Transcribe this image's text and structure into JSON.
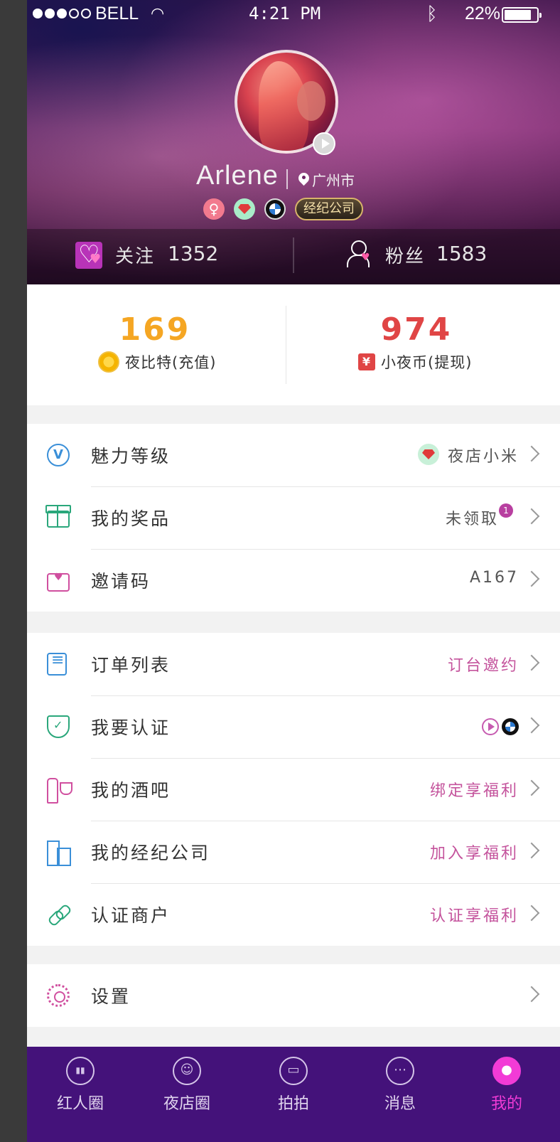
{
  "status_bar": {
    "carrier": "BELL",
    "time": "4:21 PM",
    "battery": "22%",
    "battery_level": 0.85
  },
  "profile": {
    "name": "Arlene",
    "location": "广州市",
    "gender_symbol": "♀",
    "agency_badge": "经纪公司",
    "follow_label": "关注",
    "follow_count": "1352",
    "fans_label": "粉丝",
    "fans_count": "1583"
  },
  "wallet": {
    "left_value": "169",
    "left_label": "夜比特(充值)",
    "right_value": "974",
    "right_label": "小夜币(提现)",
    "yen_symbol": "¥"
  },
  "group1": [
    {
      "label": "魅力等级",
      "right": "夜店小米",
      "icon": "v-badge-icon"
    },
    {
      "label": "我的奖品",
      "right": "未领取",
      "badge": "1",
      "icon": "gift-icon"
    },
    {
      "label": "邀请码",
      "right": "A167",
      "icon": "invite-mail-icon"
    }
  ],
  "group2": [
    {
      "label": "订单列表",
      "right": "订台邀约",
      "icon": "clipboard-icon"
    },
    {
      "label": "我要认证",
      "right": "",
      "icon": "shield-check-icon"
    },
    {
      "label": "我的酒吧",
      "right": "绑定享福利",
      "icon": "wine-icon"
    },
    {
      "label": "我的经纪公司",
      "right": "加入享福利",
      "icon": "building-icon"
    },
    {
      "label": "认证商户",
      "right": "认证享福利",
      "icon": "link-icon"
    }
  ],
  "group3": [
    {
      "label": "设置",
      "right": "",
      "icon": "gear-icon"
    }
  ],
  "tabs": [
    {
      "label": "红人圈",
      "icon": "bar-chart-icon"
    },
    {
      "label": "夜店圈",
      "icon": "people-icon"
    },
    {
      "label": "拍拍",
      "icon": "camera-icon"
    },
    {
      "label": "消息",
      "icon": "message-icon"
    },
    {
      "label": "我的",
      "icon": "me-icon",
      "active": true
    }
  ],
  "colors": {
    "tabbar_bg": "#44127a",
    "tab_active": "#f23bd6",
    "yellow_value": "#f5a623",
    "red_value": "#e04545",
    "pink_text": "#c4539c"
  }
}
